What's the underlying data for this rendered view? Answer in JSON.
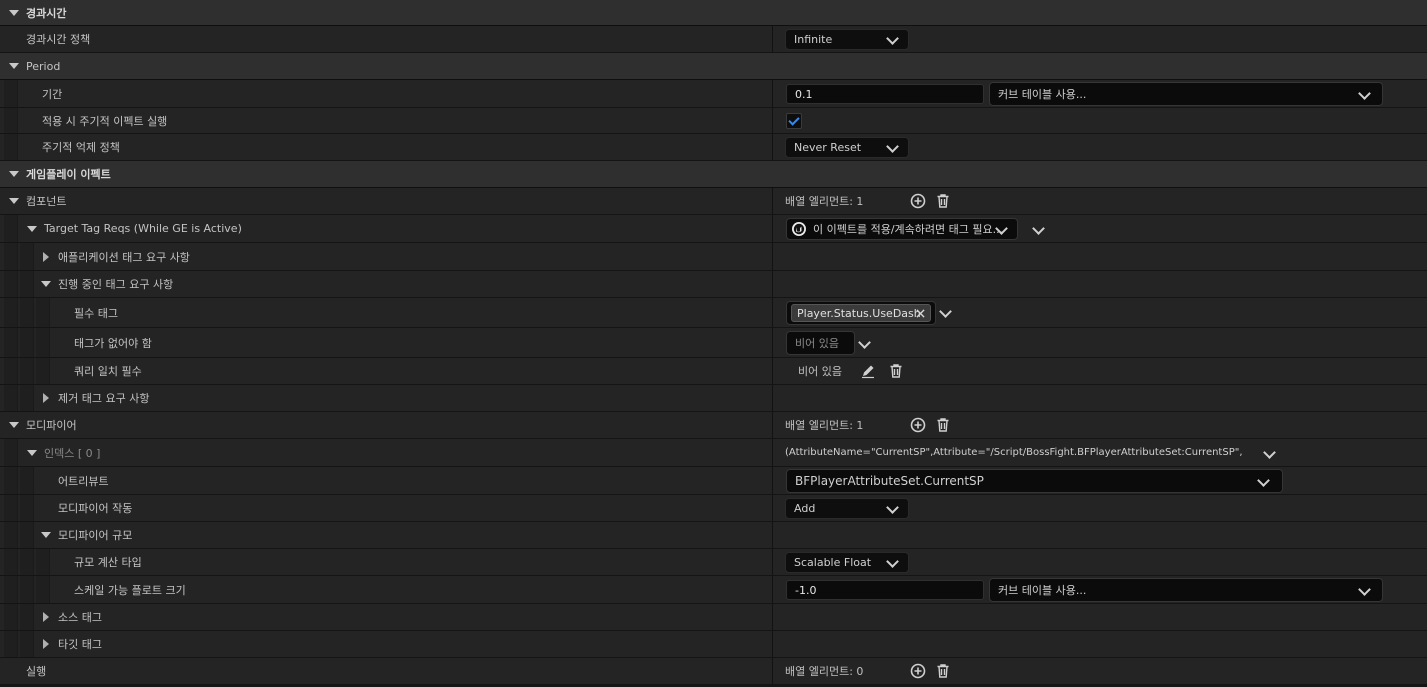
{
  "sections": {
    "duration": "경과시간",
    "period": "Period",
    "gameplay_effect": "게임플레이 이펙트"
  },
  "rows": {
    "duration_policy": {
      "label": "경과시간 정책",
      "value": "Infinite"
    },
    "period_value": {
      "label": "기간",
      "value": "0.1",
      "curve": "커브 테이블 사용..."
    },
    "execute_on_apply": {
      "label": "적용 시 주기적 이펙트 실행",
      "checked": true
    },
    "inhibition_policy": {
      "label": "주기적 억제 정책",
      "value": "Never Reset"
    },
    "components": {
      "label": "컴포넌트",
      "value": "배열 엘리먼트: 1"
    },
    "target_tag_reqs": {
      "label": "Target Tag Reqs (While GE is Active)",
      "value": "이 이펙트를 적용/계속하려면 태그 필요..."
    },
    "application_tag_req": {
      "label": "애플리케이션 태그 요구 사항"
    },
    "ongoing_tag_req": {
      "label": "진행 중인 태그 요구 사항"
    },
    "require_tags": {
      "label": "필수 태그",
      "tag": "Player.Status.UseDash"
    },
    "ignore_tags": {
      "label": "태그가 없어야 함",
      "value": "비어 있음"
    },
    "tag_query": {
      "label": "쿼리 일치 필수",
      "value": "비어 있음"
    },
    "removal_tag_req": {
      "label": "제거 태그 요구 사항"
    },
    "modifiers": {
      "label": "모디파이어",
      "value": "배열 엘리먼트: 1"
    },
    "index0": {
      "label": "인덱스 [ 0 ]",
      "value": "(AttributeName=\"CurrentSP\",Attribute=\"/Script/BossFight.BFPlayerAttributeSet:CurrentSP\","
    },
    "attribute": {
      "label": "어트리뷰트",
      "value": "BFPlayerAttributeSet.CurrentSP"
    },
    "modifier_op": {
      "label": "모디파이어 작동",
      "value": "Add"
    },
    "modifier_magnitude": {
      "label": "모디파이어 규모"
    },
    "magnitude_calc_type": {
      "label": "규모 계산 타입",
      "value": "Scalable Float"
    },
    "scalable_float": {
      "label": "스케일 가능 플로트 크기",
      "value": "-1.0",
      "curve": "커브 테이블 사용..."
    },
    "source_tags": {
      "label": "소스 태그"
    },
    "target_tags": {
      "label": "타깃 태그"
    },
    "executions": {
      "label": "실행",
      "value": "배열 엘리먼트: 0"
    }
  },
  "icons": {
    "add": "plus-circle-icon",
    "delete": "trash-icon",
    "edit": "pencil-icon",
    "remove_tag": "close-icon",
    "component": "unreal-logo-icon",
    "checkbox_color": "#2a8cff"
  }
}
